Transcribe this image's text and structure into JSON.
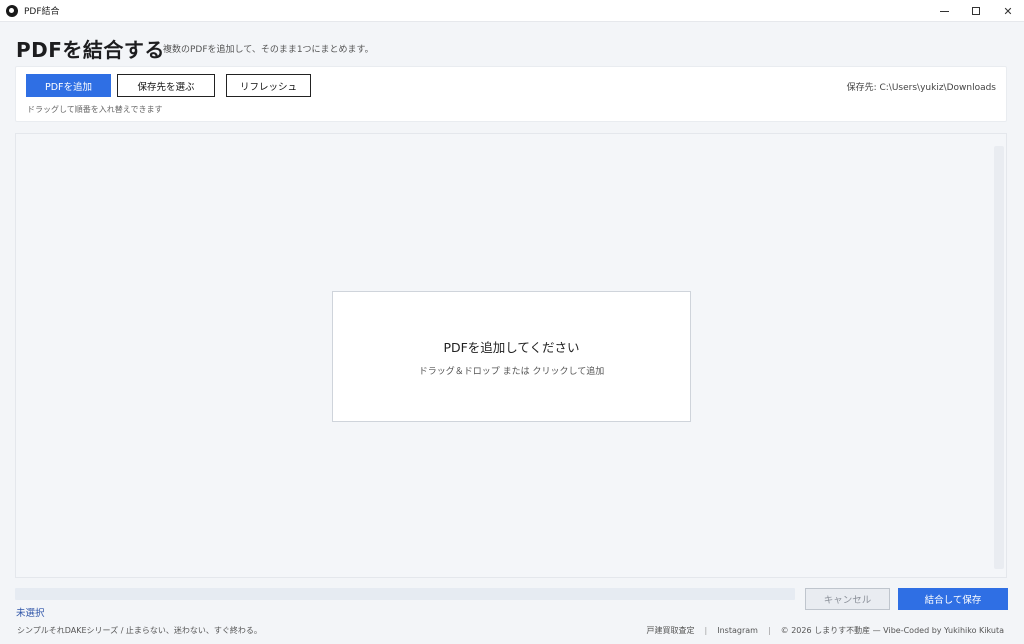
{
  "window": {
    "title": "PDF結合",
    "controls": {
      "minimize": "minimize",
      "maximize": "maximize",
      "close": "✕"
    }
  },
  "header": {
    "title": "PDFを結合する",
    "subtitle": "複数のPDFを追加して、そのまま1つにまとめます。"
  },
  "toolbar": {
    "add_label": "PDFを追加",
    "dest_label": "保存先を選ぶ",
    "refresh_label": "リフレッシュ",
    "save_path": "保存先: C:\\Users\\yukiz\\Downloads",
    "hint": "ドラッグして順番を入れ替えできます"
  },
  "drop_zone": {
    "title": "PDFを追加してください",
    "subtitle": "ドラッグ＆ドロップ または クリックして追加"
  },
  "status": {
    "progress_percent": 0,
    "text": "未選択"
  },
  "actions": {
    "cancel_label": "キャンセル",
    "merge_label": "結合して保存"
  },
  "footer": {
    "tagline": "シンプルそれDAKEシリーズ / 止まらない、迷わない、すぐ終わる。",
    "link_appraisal": "戸建買取査定",
    "link_instagram": "Instagram",
    "copyright": "© 2026 しまりす不動産 — Vibe-Coded by Yukihiko Kikuta",
    "separator": "|"
  },
  "colors": {
    "accent": "#2f6fe4",
    "status_text": "#2f55a8"
  }
}
